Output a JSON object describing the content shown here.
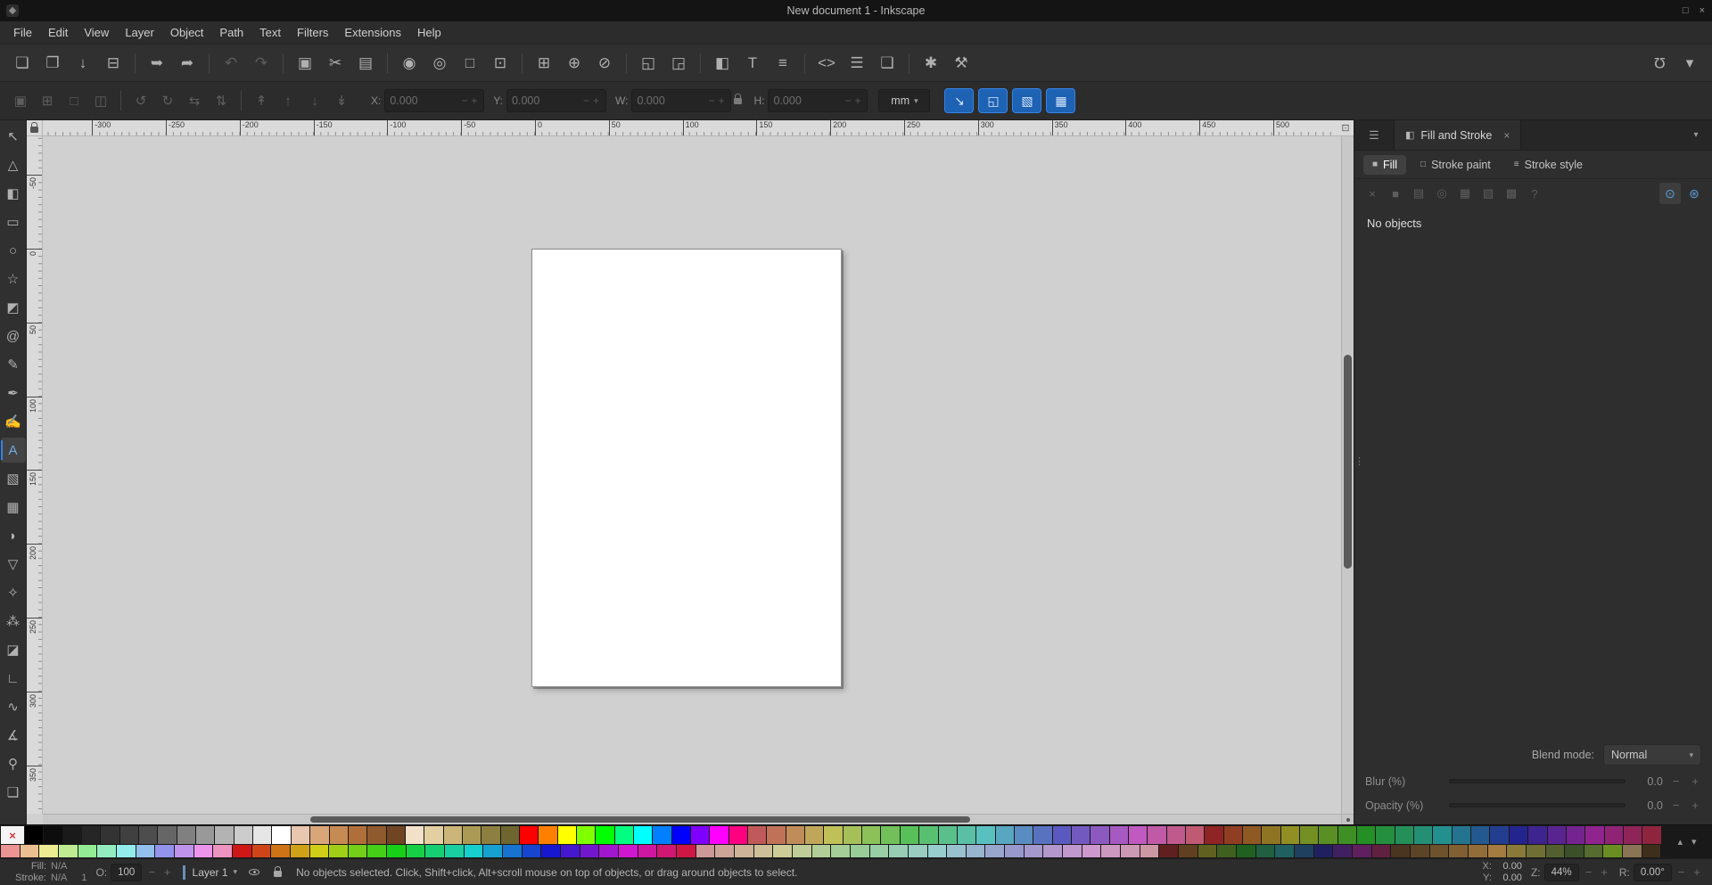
{
  "window": {
    "title": "New document 1 - Inkscape",
    "controls": {
      "maximize": "□",
      "close": "×"
    }
  },
  "glyphs": {
    "chevron_down": "▾",
    "chevron_up": "▴",
    "minus": "−",
    "plus": "+",
    "grip": "⋮"
  },
  "menu": {
    "items": [
      "File",
      "Edit",
      "View",
      "Layer",
      "Object",
      "Path",
      "Text",
      "Filters",
      "Extensions",
      "Help"
    ]
  },
  "command_toolbar": {
    "groups": [
      [
        {
          "name": "new-document-button",
          "glyph": "❏"
        },
        {
          "name": "open-document-button",
          "glyph": "❐"
        },
        {
          "name": "save-document-button",
          "glyph": "↓"
        },
        {
          "name": "print-button",
          "glyph": "⊟"
        }
      ],
      [
        {
          "name": "import-button",
          "glyph": "➥"
        },
        {
          "name": "export-button",
          "glyph": "➦"
        }
      ],
      [
        {
          "name": "undo-button",
          "glyph": "↶",
          "disabled": true
        },
        {
          "name": "redo-button",
          "glyph": "↷",
          "disabled": true
        }
      ],
      [
        {
          "name": "copy-button",
          "glyph": "▣"
        },
        {
          "name": "cut-button",
          "glyph": "✂"
        },
        {
          "name": "paste-button",
          "glyph": "▤"
        }
      ],
      [
        {
          "name": "zoom-selection-button",
          "glyph": "◉"
        },
        {
          "name": "zoom-drawing-button",
          "glyph": "◎"
        },
        {
          "name": "zoom-page-button",
          "glyph": "□"
        },
        {
          "name": "zoom-center-page-button",
          "glyph": "⊡"
        }
      ],
      [
        {
          "name": "duplicate-button",
          "glyph": "⊞"
        },
        {
          "name": "create-clone-button",
          "glyph": "⊕"
        },
        {
          "name": "unlink-clone-button",
          "glyph": "⊘"
        }
      ],
      [
        {
          "name": "group-button",
          "glyph": "◱"
        },
        {
          "name": "ungroup-button",
          "glyph": "◲"
        }
      ],
      [
        {
          "name": "fill-stroke-dialog-button",
          "glyph": "◧"
        },
        {
          "name": "text-dialog-button",
          "glyph": "T"
        },
        {
          "name": "layers-dialog-button",
          "glyph": "≡"
        }
      ],
      [
        {
          "name": "xml-editor-button",
          "glyph": "<>"
        },
        {
          "name": "align-distribute-dialog-button",
          "glyph": "☰"
        },
        {
          "name": "document-properties-button",
          "glyph": "❑"
        }
      ],
      [
        {
          "name": "find-replace-button",
          "glyph": "✱"
        },
        {
          "name": "preferences-button",
          "glyph": "⚒"
        }
      ]
    ],
    "right": [
      {
        "name": "snap-controls-button",
        "glyph": "Ω"
      },
      {
        "name": "snap-options-button",
        "glyph": "▾"
      }
    ]
  },
  "tool_controls": {
    "select_buttons": [
      {
        "name": "select-all-button",
        "glyph": "▣"
      },
      {
        "name": "select-all-layers-button",
        "glyph": "⊞"
      },
      {
        "name": "deselect-button",
        "glyph": "□"
      },
      {
        "name": "select-inverse-button",
        "glyph": "◫"
      }
    ],
    "transform_buttons": [
      {
        "name": "rotate-ccw-button",
        "glyph": "↺"
      },
      {
        "name": "rotate-cw-button",
        "glyph": "↻"
      },
      {
        "name": "flip-horizontal-button",
        "glyph": "⇆"
      },
      {
        "name": "flip-vertical-button",
        "glyph": "⇅"
      }
    ],
    "z_order_buttons": [
      {
        "name": "raise-to-top-button",
        "glyph": "↟"
      },
      {
        "name": "raise-button",
        "glyph": "↑"
      },
      {
        "name": "lower-button",
        "glyph": "↓"
      },
      {
        "name": "lower-to-bottom-button",
        "glyph": "↡"
      }
    ],
    "fields": [
      {
        "label": "X:",
        "value": "0.000"
      },
      {
        "label": "Y:",
        "value": "0.000"
      },
      {
        "label": "W:",
        "value": "0.000"
      },
      {
        "label": "H:",
        "value": "0.000"
      }
    ],
    "unit": "mm",
    "toggles": [
      {
        "name": "scale-stroke-toggle",
        "glyph": "↘"
      },
      {
        "name": "scale-corners-toggle",
        "glyph": "◱"
      },
      {
        "name": "move-gradients-toggle",
        "glyph": "▧"
      },
      {
        "name": "move-patterns-toggle",
        "glyph": "▦"
      }
    ]
  },
  "toolbox": {
    "tools": [
      {
        "name": "selector-tool",
        "glyph": "↖",
        "selected": false
      },
      {
        "name": "node-tool",
        "glyph": "△",
        "selected": false
      },
      {
        "name": "shape-builder-tool",
        "glyph": "◧",
        "selected": false
      },
      {
        "name": "rectangle-tool",
        "glyph": "▭",
        "selected": false
      },
      {
        "name": "ellipse-tool",
        "glyph": "○",
        "selected": false
      },
      {
        "name": "star-tool",
        "glyph": "☆",
        "selected": false
      },
      {
        "name": "box-3d-tool",
        "glyph": "◩",
        "selected": false
      },
      {
        "name": "spiral-tool",
        "glyph": "@",
        "selected": false
      },
      {
        "name": "pencil-tool",
        "glyph": "✎",
        "selected": false
      },
      {
        "name": "pen-tool",
        "glyph": "✒",
        "selected": false
      },
      {
        "name": "calligraphy-tool",
        "glyph": "✍",
        "selected": false
      },
      {
        "name": "text-tool",
        "glyph": "A",
        "selected": true
      },
      {
        "name": "gradient-tool",
        "glyph": "▧",
        "selected": false
      },
      {
        "name": "mesh-tool",
        "glyph": "▦",
        "selected": false
      },
      {
        "name": "dropper-tool",
        "glyph": "◗",
        "selected": false
      },
      {
        "name": "paint-bucket-tool",
        "glyph": "▽",
        "selected": false
      },
      {
        "name": "tweak-tool",
        "glyph": "✧",
        "selected": false
      },
      {
        "name": "spray-tool",
        "glyph": "⁂",
        "selected": false
      },
      {
        "name": "eraser-tool",
        "glyph": "◪",
        "selected": false
      },
      {
        "name": "connector-tool",
        "glyph": "∟",
        "selected": false
      },
      {
        "name": "lpe-tool",
        "glyph": "∿",
        "selected": false
      },
      {
        "name": "measure-tool",
        "glyph": "∡",
        "selected": false
      },
      {
        "name": "zoom-tool",
        "glyph": "⚲",
        "selected": false
      },
      {
        "name": "pages-tool",
        "glyph": "❑",
        "selected": false
      }
    ]
  },
  "canvas": {
    "ruler_h_labels": [
      "-300",
      "-250",
      "-200",
      "-150",
      "-100",
      "-50",
      "0",
      "50",
      "100",
      "150",
      "200",
      "250",
      "300",
      "350",
      "400",
      "450",
      "500"
    ],
    "ruler_v_labels": [
      "-50",
      "0",
      "50",
      "100",
      "150",
      "200",
      "250",
      "300",
      "350"
    ],
    "cms_glyph": "⊡",
    "background": "#d0d0d0",
    "page_color": "#ffffff"
  },
  "panel": {
    "dock": {
      "switcher_icon": "☰",
      "tab_icon": "◧",
      "tab_title": "Fill and Stroke",
      "close_glyph": "×"
    },
    "tabs": [
      {
        "name": "tab-fill",
        "label": "Fill",
        "icon": "■",
        "active": true
      },
      {
        "name": "tab-stroke-paint",
        "label": "Stroke paint",
        "icon": "□",
        "active": false
      },
      {
        "name": "tab-stroke-style",
        "label": "Stroke style",
        "icon": "≡",
        "active": false
      }
    ],
    "paint_buttons": [
      {
        "name": "paint-none-button",
        "glyph": "×"
      },
      {
        "name": "paint-flat-color-button",
        "glyph": "■"
      },
      {
        "name": "paint-linear-gradient-button",
        "glyph": "▤"
      },
      {
        "name": "paint-radial-gradient-button",
        "glyph": "◎"
      },
      {
        "name": "paint-pattern-button",
        "glyph": "▦"
      },
      {
        "name": "paint-swatch-button",
        "glyph": "▧"
      },
      {
        "name": "paint-mesh-button",
        "glyph": "▩"
      },
      {
        "name": "paint-unknown-button",
        "glyph": "?"
      }
    ],
    "fill_rule_buttons": [
      {
        "name": "fill-rule-even-odd-button",
        "glyph": "⊙",
        "active": true
      },
      {
        "name": "fill-rule-nonzero-button",
        "glyph": "⊛",
        "active": false
      }
    ],
    "status": "No objects",
    "blend": {
      "label": "Blend mode:",
      "value": "Normal"
    },
    "blur": {
      "label": "Blur (%)",
      "value": "0.0"
    },
    "opacity": {
      "label": "Opacity (%)",
      "value": "0.0"
    }
  },
  "palette": {
    "remove_glyph": "×",
    "rows": [
      [
        "#000000",
        "#0d0d0d",
        "#1a1a1a",
        "#262626",
        "#333333",
        "#404040",
        "#4d4d4d",
        "#666666",
        "#808080",
        "#999999",
        "#b3b3b3",
        "#cccccc",
        "#e6e6e6",
        "#ffffff",
        "#e9c6af",
        "#d9a679",
        "#c68a53",
        "#b06f3a",
        "#8f5a2e",
        "#6f4523",
        "#f2e0c9",
        "#e3cfa1",
        "#cbb578",
        "#ab9a55",
        "#8c7f3f",
        "#6e652f",
        "#ff0000",
        "#ff8000",
        "#ffff00",
        "#80ff00",
        "#00ff00",
        "#00ff80",
        "#00ffff",
        "#0080ff",
        "#0000ff",
        "#8000ff",
        "#ff00ff",
        "#ff0080",
        "#c05959",
        "#c07259",
        "#c08c59",
        "#c0a659",
        "#c0c059",
        "#a6c059",
        "#8cc059",
        "#72c059",
        "#59c059",
        "#59c072",
        "#59c08c",
        "#59c0a6",
        "#59c0c0",
        "#59a6c0",
        "#598cc0",
        "#5972c0",
        "#5959c0",
        "#7259c0",
        "#8c59c0",
        "#a659c0",
        "#c059c0",
        "#c059a6",
        "#c0598c",
        "#c05972",
        "#8f2424",
        "#8f3e24",
        "#8f5924",
        "#8f7424",
        "#8f8f24",
        "#748f24",
        "#598f24",
        "#3e8f24",
        "#248f24",
        "#248f3e",
        "#248f59",
        "#248f74",
        "#248f8f",
        "#24748f",
        "#24598f",
        "#243e8f",
        "#24248f",
        "#3e248f",
        "#59248f",
        "#74248f",
        "#8f248f",
        "#8f2474",
        "#8f2459",
        "#8f243e"
      ],
      [
        "#ec9393",
        "#ecbf93",
        "#ecec93",
        "#bfec93",
        "#93ec93",
        "#93ecbf",
        "#93ecec",
        "#93bfec",
        "#9393ec",
        "#bf93ec",
        "#ec93ec",
        "#ec93bf",
        "#cf1717",
        "#cf4517",
        "#cf7317",
        "#cfa117",
        "#cfcf17",
        "#a1cf17",
        "#73cf17",
        "#45cf17",
        "#17cf17",
        "#17cf45",
        "#17cf73",
        "#17cfa1",
        "#17cfcf",
        "#17a1cf",
        "#1773cf",
        "#1745cf",
        "#1717cf",
        "#4517cf",
        "#7317cf",
        "#a117cf",
        "#cf17cf",
        "#cf17a1",
        "#cf1773",
        "#cf1745",
        "#cd9898",
        "#cda598",
        "#cdb398",
        "#cdc098",
        "#cdcd98",
        "#c0cd98",
        "#b3cd98",
        "#a5cd98",
        "#98cd98",
        "#98cda5",
        "#98cdb3",
        "#98cdc0",
        "#98cdcd",
        "#98c0cd",
        "#98b3cd",
        "#98a5cd",
        "#9898cd",
        "#a598cd",
        "#b398cd",
        "#c098cd",
        "#cd98cd",
        "#cd98c0",
        "#cd98b3",
        "#cd98a5",
        "#602020",
        "#604020",
        "#606020",
        "#406020",
        "#206020",
        "#206040",
        "#206060",
        "#204060",
        "#202060",
        "#402060",
        "#602060",
        "#602040",
        "#4a3520",
        "#5c4426",
        "#6e522d",
        "#805f33",
        "#926d39",
        "#a47b40",
        "#8a7a3a",
        "#6f6f35",
        "#545f30",
        "#3a4f2a",
        "#556b2f",
        "#6b8e23",
        "#8b7355",
        "#3e2f1c"
      ]
    ]
  },
  "statusbar": {
    "fill_label": "Fill:",
    "fill_value": "N/A",
    "stroke_label": "Stroke:",
    "stroke_value": "N/A",
    "stroke_width": "1",
    "opacity_label": "O:",
    "opacity_value": "100",
    "layer_name": "Layer 1",
    "message": "No objects selected. Click, Shift+click, Alt+scroll mouse on top of objects, or drag around objects to select.",
    "x_label": "X:",
    "x_value": "0.00",
    "y_label": "Y:",
    "y_value": "0.00",
    "zoom_label": "Z:",
    "zoom_value": "44%",
    "rotation_label": "R:",
    "rotation_value": "0.00°"
  },
  "colors": {
    "accent": "#3584e4",
    "canvas_bg": "#d0d0d0",
    "selected_tool_icon": "#74aae4"
  }
}
